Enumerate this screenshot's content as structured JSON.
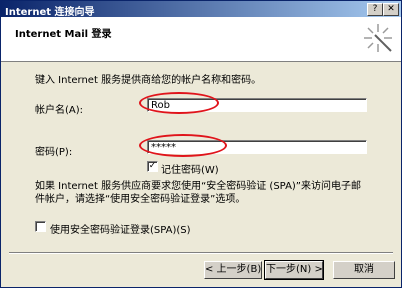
{
  "window": {
    "title": "Internet 连接向导"
  },
  "header": {
    "title": "Internet Mail 登录"
  },
  "content": {
    "instruction": "键入 Internet 服务提供商给您的帐户名称和密码。",
    "account_label": "帐户名(A):",
    "account_value": "Rob",
    "password_label": "密码(P):",
    "password_value": "*****",
    "remember_label": "记住密码(W)",
    "remember_checked": "✓",
    "spa_paragraph_1": "如果 Internet 服务供应商要求您使用“安全密码验证 (SPA)”来访问电子邮",
    "spa_paragraph_2": "件帐户，请选择“使用安全密码验证登录”选项。",
    "spa_label": "使用安全密码验证登录(SPA)(S)",
    "spa_checked": ""
  },
  "buttons": {
    "back": "< 上一步(B)",
    "next": "下一步(N) >",
    "cancel": "取消"
  },
  "colors": {
    "annotation": "#e0141b",
    "titlebar": "#0a246a"
  },
  "icons": {
    "wizard": "wizard-wand-icon"
  }
}
